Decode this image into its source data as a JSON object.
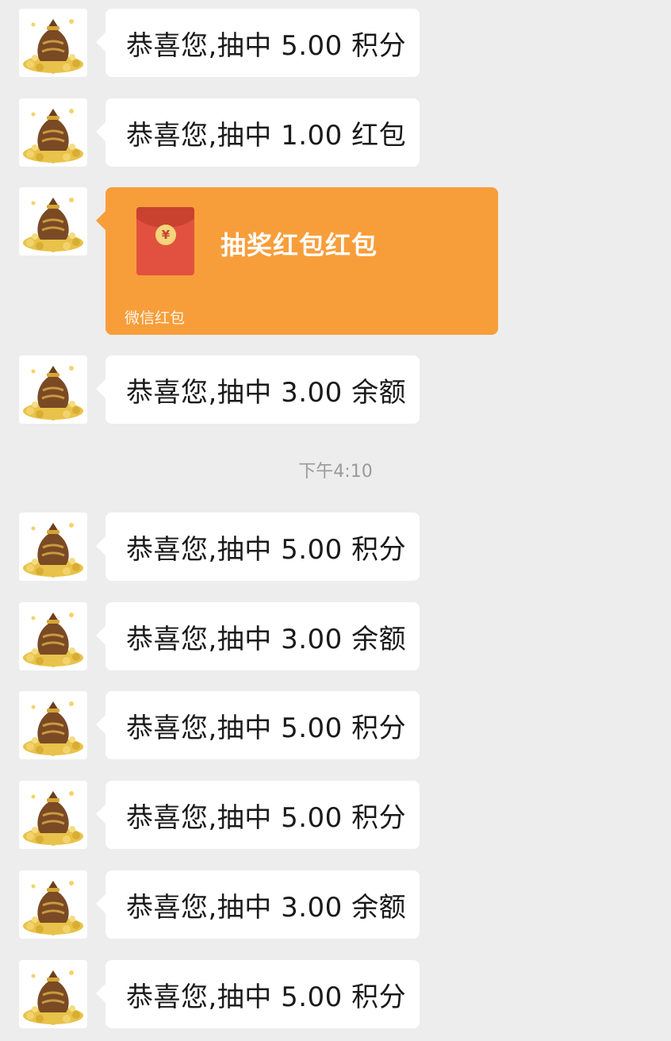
{
  "messages": [
    {
      "type": "text",
      "text": "恭喜您,抽中 5.00 积分"
    },
    {
      "type": "text",
      "text": "恭喜您,抽中 1.00 红包"
    },
    {
      "type": "redpacket",
      "title": "抽奖红包红包",
      "footer": "微信红包",
      "currency_symbol": "¥"
    },
    {
      "type": "text",
      "text": "恭喜您,抽中 3.00 余额"
    },
    {
      "type": "timestamp",
      "text": "下午4:10"
    },
    {
      "type": "text",
      "text": "恭喜您,抽中 5.00 积分"
    },
    {
      "type": "text",
      "text": "恭喜您,抽中 3.00 余额"
    },
    {
      "type": "text",
      "text": "恭喜您,抽中 5.00 积分"
    },
    {
      "type": "text",
      "text": "恭喜您,抽中 5.00 积分"
    },
    {
      "type": "text",
      "text": "恭喜您,抽中 3.00 余额"
    },
    {
      "type": "text",
      "text": "恭喜您,抽中 5.00 积分"
    }
  ],
  "colors": {
    "background": "#ededed",
    "bubble": "#ffffff",
    "redpacket_card": "#f79e3b",
    "redpacket_icon": "#e2513f",
    "timestamp_text": "#9a9a9a"
  },
  "icons": {
    "avatar": "money-bag-icon",
    "redpacket": "red-envelope-icon"
  }
}
